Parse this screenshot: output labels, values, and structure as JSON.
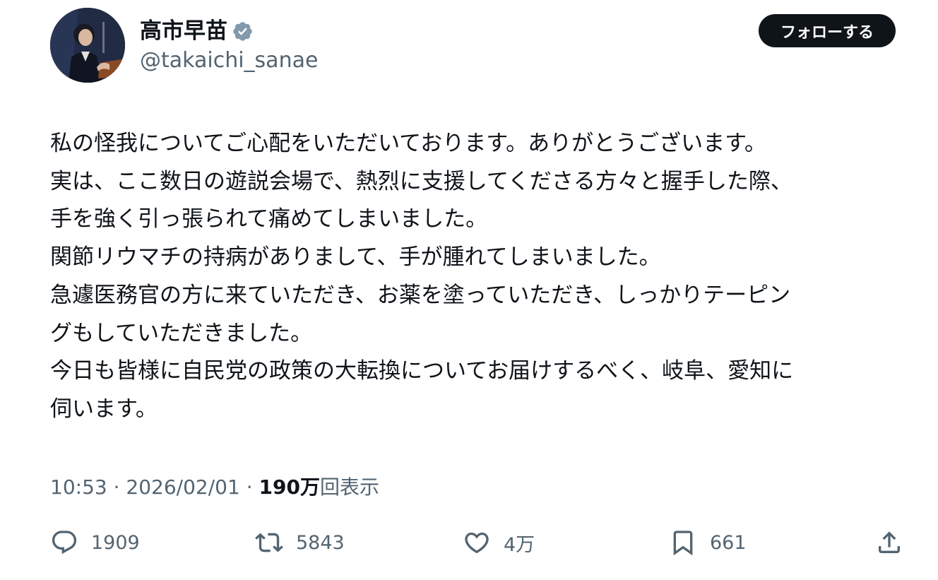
{
  "author": {
    "display_name": "高市早苗",
    "handle": "@takaichi_sanae",
    "verified_icon": "verified-badge-icon",
    "verified_color": "#829aab"
  },
  "follow_button": {
    "label": "フォローする"
  },
  "tweet": {
    "lines": [
      "私の怪我についてご心配をいただいております。ありがとうございます。",
      "実は、ここ数日の遊説会場で、熱烈に支援してくださる方々と握手した際、",
      "手を強く引っ張られて痛めてしまいました。",
      "関節リウマチの持病がありまして、手が腫れてしまいました。",
      "急遽医務官の方に来ていただき、お薬を塗っていただき、しっかりテーピン",
      "グもしていただきました。",
      "今日も皆様に自民党の政策の大転換についてお届けするべく、岐阜、愛知に",
      "伺います。"
    ]
  },
  "meta": {
    "time": "10:53",
    "separator": " · ",
    "date": "2026/02/01",
    "views_count": "190万",
    "views_label": "回表示"
  },
  "actions": {
    "reply": {
      "icon": "reply-icon",
      "count": "1909"
    },
    "repost": {
      "icon": "repost-icon",
      "count": "5843"
    },
    "like": {
      "icon": "heart-icon",
      "count": "4万"
    },
    "bookmark": {
      "icon": "bookmark-icon",
      "count": "661"
    },
    "share": {
      "icon": "share-icon"
    }
  },
  "colors": {
    "text_primary": "#0f1419",
    "text_secondary": "#536471",
    "button_bg": "#0f1419",
    "button_text": "#ffffff"
  }
}
